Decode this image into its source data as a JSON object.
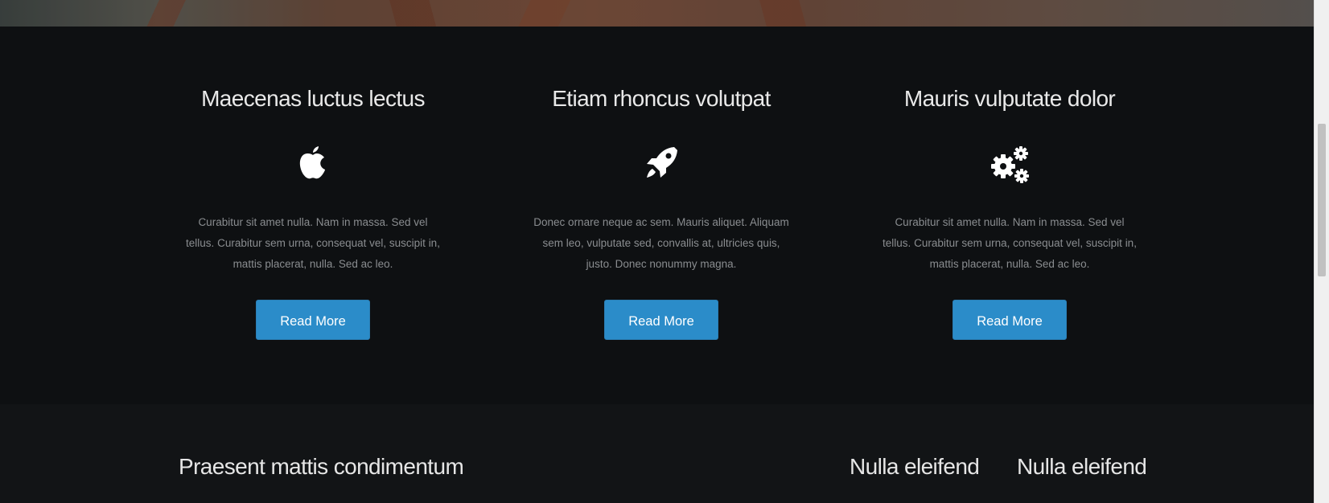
{
  "features": [
    {
      "title": "Maecenas luctus lectus",
      "icon": "apple-icon",
      "text": "Curabitur sit amet nulla. Nam in massa. Sed vel tellus. Curabitur sem urna, consequat vel, suscipit in, mattis placerat, nulla. Sed ac leo.",
      "button": "Read More"
    },
    {
      "title": "Etiam rhoncus volutpat",
      "icon": "rocket-icon",
      "text": "Donec ornare neque ac sem. Mauris aliquet. Aliquam sem leo, vulputate sed, convallis at, ultricies quis, justo. Donec nonummy magna.",
      "button": "Read More"
    },
    {
      "title": "Mauris vulputate dolor",
      "icon": "gears-icon",
      "text": "Curabitur sit amet nulla. Nam in massa. Sed vel tellus. Curabitur sem urna, consequat vel, suscipit in, mattis placerat, nulla. Sed ac leo.",
      "button": "Read More"
    }
  ],
  "lower": {
    "heading_left": "Praesent mattis condimentum",
    "heading_mid": "Nulla eleifend",
    "heading_right": "Nulla eleifend"
  },
  "colors": {
    "accent": "#2b8cc9",
    "background": "#0e1012"
  }
}
